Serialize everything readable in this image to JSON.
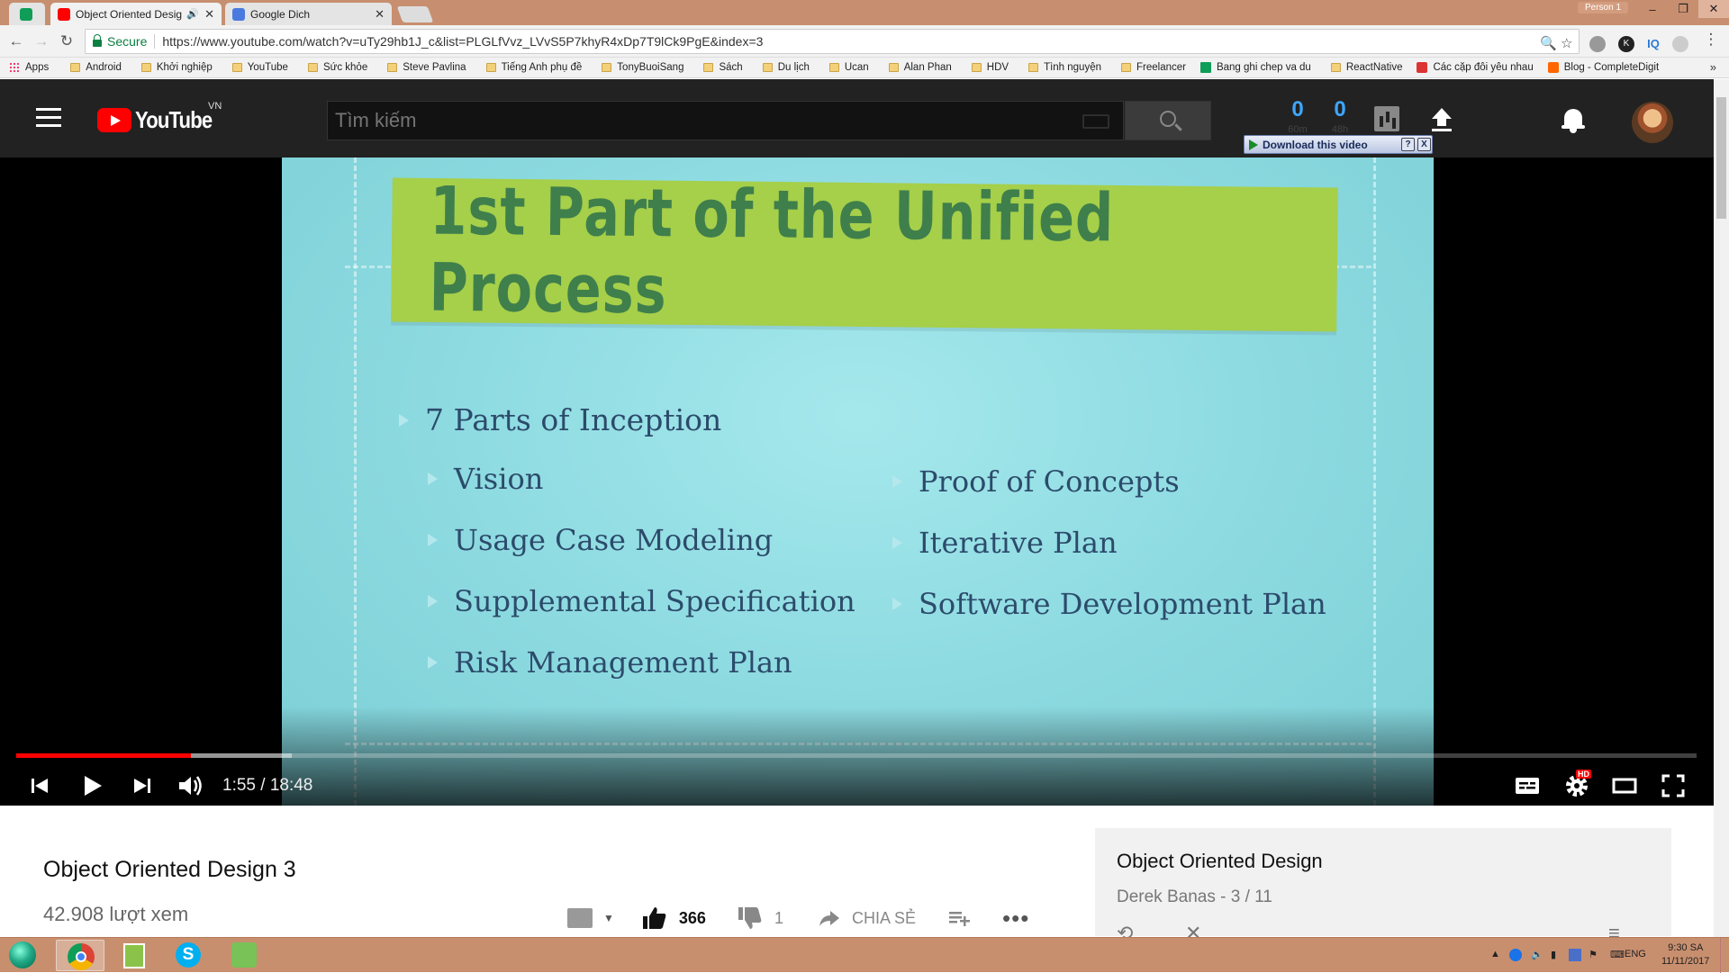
{
  "browser": {
    "tabs": [
      {
        "title": "Object Oriented Desig",
        "active": true
      },
      {
        "title": "Google Dich",
        "active": false
      }
    ],
    "profile": "Person 1",
    "secure_label": "Secure",
    "url": "https://www.youtube.com/watch?v=uTy29hb1J_c&list=PLGLfVvz_LVvS5P7khyR4xDp7T9lCk9PgE&index=3",
    "bookmarks": [
      "Apps",
      "Android",
      "Khởi nghiệp",
      "YouTube",
      "Sức khỏe",
      "Steve Pavlina",
      "Tiếng Anh phụ đề",
      "TonyBuoiSang",
      "Sách",
      "Du lịch",
      "Ucan",
      "Alan Phan",
      "HDV",
      "Tình nguyện",
      "Freelancer",
      "Bang ghi chep va du",
      "ReactNative",
      "Các cặp đôi yêu nhau",
      "Blog - CompleteDigit"
    ],
    "extension_labels": {
      "k": "K",
      "iq": "IQ"
    }
  },
  "youtube": {
    "logo_text": "YouTube",
    "country": "VN",
    "search_placeholder": "Tìm kiếm",
    "counters": [
      {
        "value": "0",
        "sub": "60m"
      },
      {
        "value": "0",
        "sub": "48h"
      }
    ],
    "download_label": "Download this video",
    "download_help": "?",
    "download_close": "X"
  },
  "video": {
    "slide_title": "1st Part of the Unified Process",
    "bullets": {
      "main": "7 Parts of Inception",
      "left": [
        "Vision",
        "Usage Case Modeling",
        "Supplemental Specification",
        "Risk Management Plan"
      ],
      "right": [
        "Proof of Concepts",
        "Iterative Plan",
        "Software Development Plan"
      ]
    },
    "time_label": "1:55 / 18:48",
    "progress_played": 0.104,
    "progress_loaded": 0.164,
    "hd_badge": "HD"
  },
  "info": {
    "title": "Object Oriented Design 3",
    "views": "42.908 lượt xem",
    "likes": "366",
    "dislikes": "1",
    "share_label": "CHIA SẺ"
  },
  "playlist": {
    "title": "Object Oriented Design",
    "subtitle": "Derek Banas - 3 / 11"
  },
  "taskbar": {
    "lang": "ENG",
    "time": "9:30 SA",
    "date": "11/11/2017"
  },
  "colors": {
    "yt_red": "#ff0000",
    "masthead": "#222222",
    "slide_bg": "#8fdce2",
    "banner": "#a6cf4a",
    "taskbar": "#c88f6f"
  }
}
